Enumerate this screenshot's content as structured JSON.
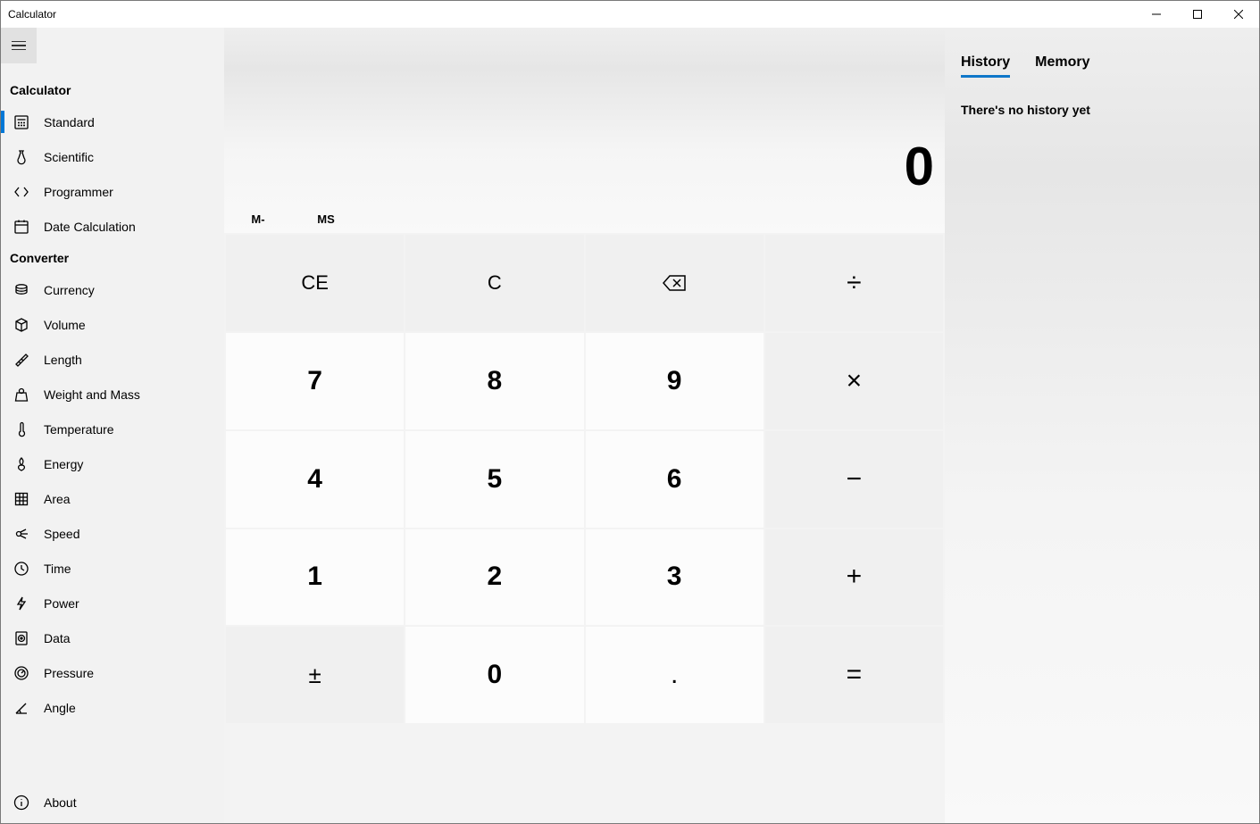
{
  "app_title": "Calculator",
  "display_value": "0",
  "nav": {
    "section1_title": "Calculator",
    "section2_title": "Converter",
    "modes": [
      {
        "label": "Standard",
        "active": true
      },
      {
        "label": "Scientific",
        "active": false
      },
      {
        "label": "Programmer",
        "active": false
      },
      {
        "label": "Date Calculation",
        "active": false
      }
    ],
    "converters": [
      {
        "label": "Currency"
      },
      {
        "label": "Volume"
      },
      {
        "label": "Length"
      },
      {
        "label": "Weight and Mass"
      },
      {
        "label": "Temperature"
      },
      {
        "label": "Energy"
      },
      {
        "label": "Area"
      },
      {
        "label": "Speed"
      },
      {
        "label": "Time"
      },
      {
        "label": "Power"
      },
      {
        "label": "Data"
      },
      {
        "label": "Pressure"
      },
      {
        "label": "Angle"
      }
    ],
    "about_label": "About"
  },
  "memory": {
    "m_minus": "M-",
    "m_store": "MS"
  },
  "keys": {
    "ce": "CE",
    "c": "C",
    "divide": "÷",
    "multiply": "×",
    "minus": "−",
    "plus": "+",
    "equals": "=",
    "plusminus": "±",
    "decimal": ".",
    "n0": "0",
    "n1": "1",
    "n2": "2",
    "n3": "3",
    "n4": "4",
    "n5": "5",
    "n6": "6",
    "n7": "7",
    "n8": "8",
    "n9": "9"
  },
  "panel": {
    "tab_history": "History",
    "tab_memory": "Memory",
    "empty_history": "There's no history yet"
  }
}
